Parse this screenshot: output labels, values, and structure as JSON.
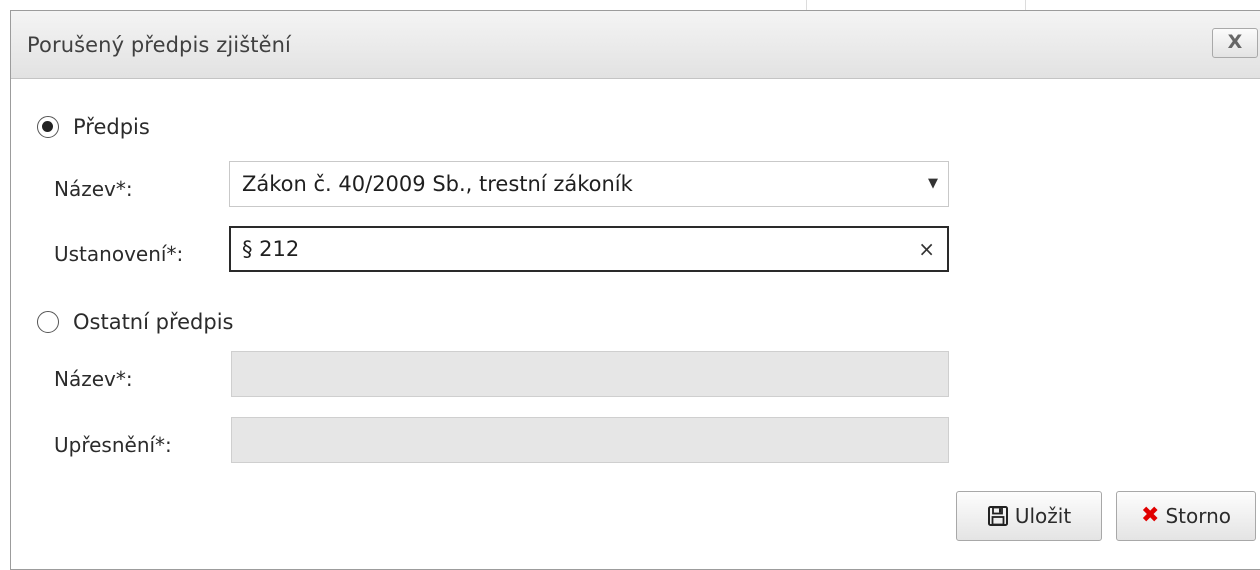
{
  "dialog": {
    "title": "Porušený předpis zjištění",
    "close_label": "X"
  },
  "predpis": {
    "radio_label": "Předpis",
    "selected": true,
    "nazev_label": "Název*:",
    "nazev_value": "Zákon č. 40/2009 Sb., trestní zákoník",
    "ustanoveni_label": "Ustanovení*:",
    "ustanoveni_value": "§ 212"
  },
  "ostatni": {
    "radio_label": "Ostatní předpis",
    "selected": false,
    "nazev_label": "Název*:",
    "nazev_value": "",
    "upresneni_label": "Upřesnění*:",
    "upresneni_value": ""
  },
  "buttons": {
    "save_label": "Uložit",
    "cancel_label": "Storno"
  },
  "icons": {
    "dropdown": "▼",
    "clear": "×",
    "save": "floppy-disk-icon",
    "cancel": "✖"
  },
  "colors": {
    "cancel_icon": "#e00000"
  }
}
